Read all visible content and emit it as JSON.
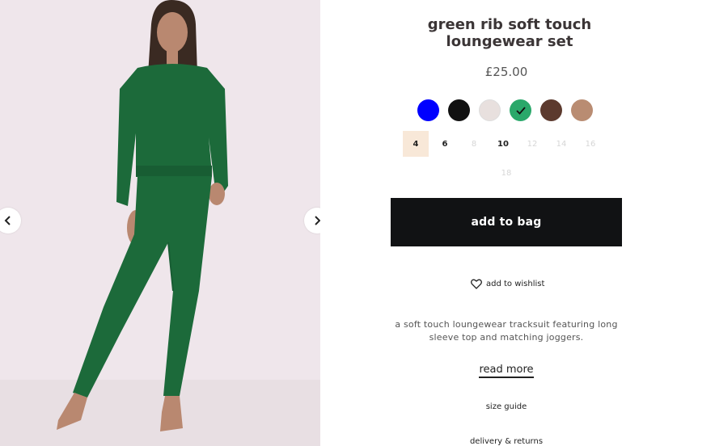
{
  "product": {
    "title": "green rib soft touch loungewear set",
    "price": "£25.00"
  },
  "swatches": [
    {
      "name": "blue",
      "color": "#0000ff",
      "selected": false
    },
    {
      "name": "black",
      "color": "#111111",
      "selected": false
    },
    {
      "name": "cream",
      "color": "#e8e0de",
      "selected": false
    },
    {
      "name": "green",
      "color": "#2aa86a",
      "selected": true
    },
    {
      "name": "chocolate",
      "color": "#5c3a2e",
      "selected": false
    },
    {
      "name": "camel",
      "color": "#b98c72",
      "selected": false
    }
  ],
  "sizes": [
    {
      "label": "4",
      "selected": true,
      "available": true
    },
    {
      "label": "6",
      "selected": false,
      "available": true
    },
    {
      "label": "8",
      "selected": false,
      "available": false
    },
    {
      "label": "10",
      "selected": false,
      "available": true
    },
    {
      "label": "12",
      "selected": false,
      "available": false
    },
    {
      "label": "14",
      "selected": false,
      "available": false
    },
    {
      "label": "16",
      "selected": false,
      "available": false
    },
    {
      "label": "18",
      "selected": false,
      "available": false
    }
  ],
  "actions": {
    "add_to_bag": "add to bag",
    "wishlist": "add to wishlist",
    "read_more": "read more",
    "size_guide": "size guide",
    "delivery_returns": "delivery & returns"
  },
  "description": "a soft touch loungewear tracksuit featuring long sleeve top and matching joggers.",
  "icons": {
    "prev": "chevron-left-icon",
    "next": "chevron-right-icon",
    "wishlist": "heart-icon",
    "selected_swatch": "checkmark-icon"
  },
  "colors": {
    "button_bg": "#111214",
    "size_selected_bg": "#f8e8d8",
    "outfit": "#1c6a3a",
    "photo_bg": "#efe6eb"
  }
}
